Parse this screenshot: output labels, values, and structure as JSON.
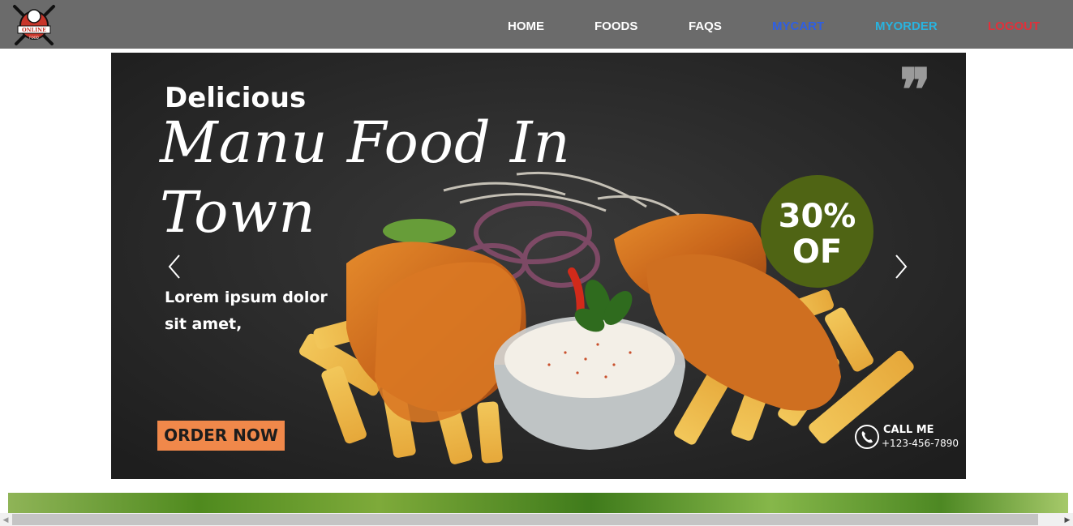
{
  "logo": {
    "text": "ONLINE",
    "subtext": "FOOD"
  },
  "nav": {
    "home": "HOME",
    "foods": "FOODS",
    "faqs": "FAQS",
    "mycart": "MYCART",
    "myorder": "MYORDER",
    "logout": "LOGOUT"
  },
  "banner": {
    "headline_small": "Delicious",
    "headline_line1": "Manu Food In",
    "headline_line2": "Town",
    "subtext": "Lorem ipsum dolor sit amet,",
    "order_button": "ORDER NOW",
    "discount_pct": "30%",
    "discount_of": "OF",
    "call_label": "CALL ME",
    "call_number": "+123-456-7890",
    "quote_mark": "❞"
  },
  "colors": {
    "navbar": "#6b6b6b",
    "cart": "#2f5fe3",
    "order": "#29b3df",
    "logout": "#e0313b",
    "order_button": "#f0884a",
    "discount": "#4f6414"
  }
}
